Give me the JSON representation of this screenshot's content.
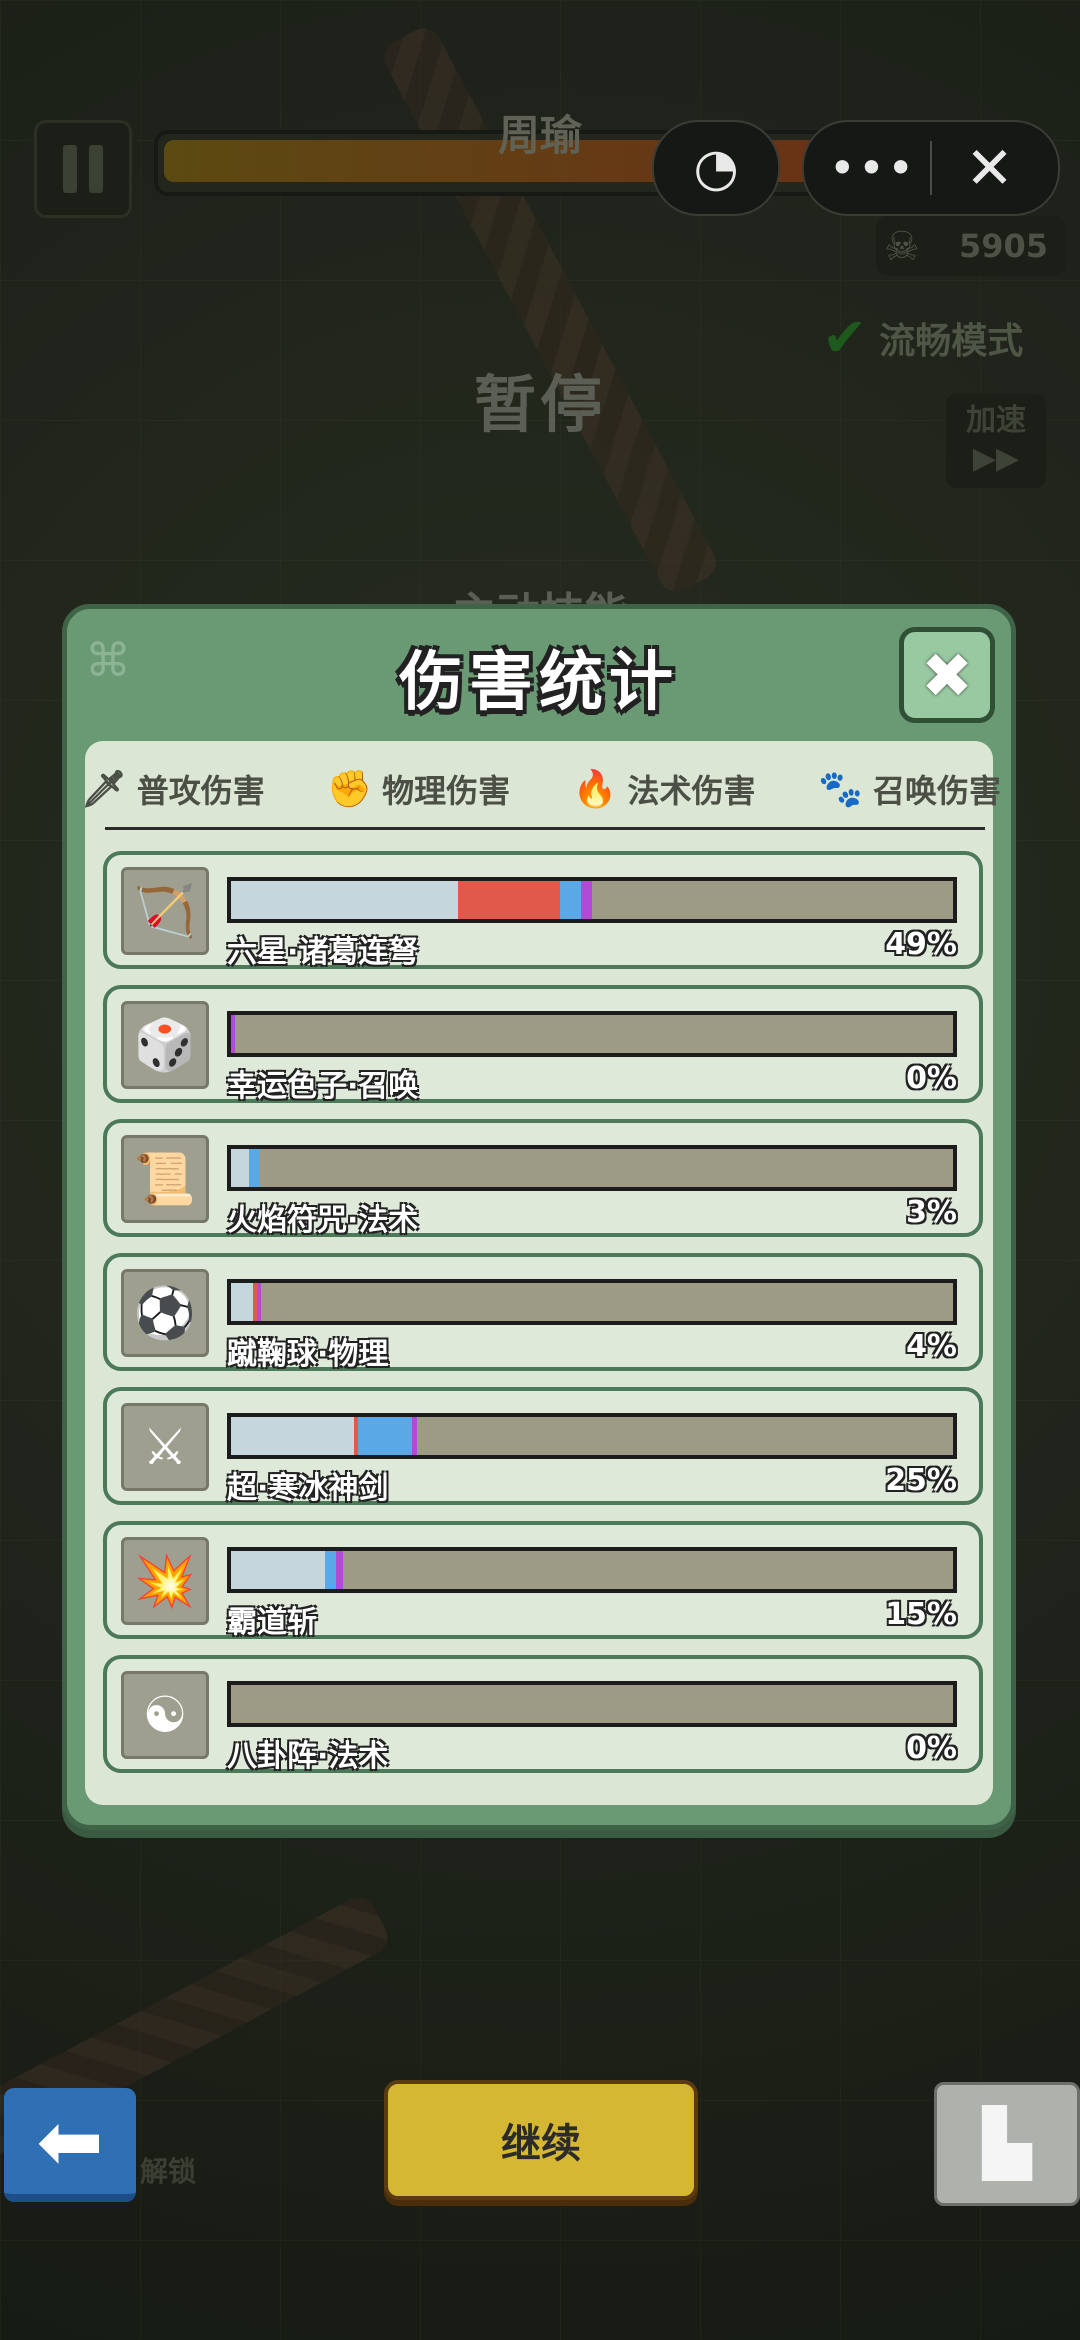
{
  "hud": {
    "boss_name": "周瑜",
    "skull_count": "5905",
    "smooth_mode": "流畅模式",
    "speed_label": "加速",
    "speed_icon": "▶▶",
    "paused_label": "暂停",
    "active_skills_label": "主动技能",
    "miniprogram_more": "•••",
    "miniprogram_close": "✕"
  },
  "panel": {
    "title": "伤害统计",
    "close_label": "✖",
    "legend": [
      {
        "label": "普攻伤害",
        "icon": "sword-icon",
        "color": "#8fd3f0",
        "glyph": "🗡"
      },
      {
        "label": "物理伤害",
        "icon": "fist-icon",
        "color": "#e25a4a",
        "glyph": "✊"
      },
      {
        "label": "法术伤害",
        "icon": "flame-icon",
        "color": "#4aa3e8",
        "glyph": "🔥"
      },
      {
        "label": "召唤伤害",
        "icon": "paw-icon",
        "color": "#b24ad6",
        "glyph": "🐾"
      }
    ],
    "rows": [
      {
        "name": "六星·诸葛连弩",
        "pct": "49%",
        "glyph": "🏹",
        "segments": {
          "normal": 0.315,
          "physical": 0.14,
          "magic": 0.03,
          "summon": 0.015
        }
      },
      {
        "name": "幸运色子·召唤",
        "pct": "0%",
        "glyph": "🎲",
        "segments": {
          "normal": 0.0,
          "physical": 0.0,
          "magic": 0.0,
          "summon": 0.006
        }
      },
      {
        "name": "火焰符咒·法术",
        "pct": "3%",
        "glyph": "📜",
        "segments": {
          "normal": 0.025,
          "physical": 0.0,
          "magic": 0.015,
          "summon": 0.0
        }
      },
      {
        "name": "蹴鞠球·物理",
        "pct": "4%",
        "glyph": "⚽",
        "segments": {
          "normal": 0.03,
          "physical": 0.006,
          "magic": 0.0,
          "summon": 0.006
        }
      },
      {
        "name": "超·寒冰神剑",
        "pct": "25%",
        "glyph": "⚔",
        "segments": {
          "normal": 0.17,
          "physical": 0.006,
          "magic": 0.075,
          "summon": 0.006
        }
      },
      {
        "name": "霸道斩",
        "pct": "15%",
        "glyph": "💥",
        "segments": {
          "normal": 0.13,
          "physical": 0.0,
          "magic": 0.015,
          "summon": 0.01
        }
      },
      {
        "name": "八卦阵·法术",
        "pct": "0%",
        "glyph": "☯",
        "segments": {
          "normal": 0.0,
          "physical": 0.0,
          "magic": 0.0,
          "summon": 0.0
        }
      }
    ]
  },
  "bottom": {
    "back_icon": "⬅",
    "lock_label": "解锁",
    "continue_label": "继续",
    "rank_icon": "▙"
  },
  "colors": {
    "normal": "#c5d7dd",
    "physical": "#e0594a",
    "magic": "#5aa8e6",
    "summon": "#b24ad6"
  }
}
